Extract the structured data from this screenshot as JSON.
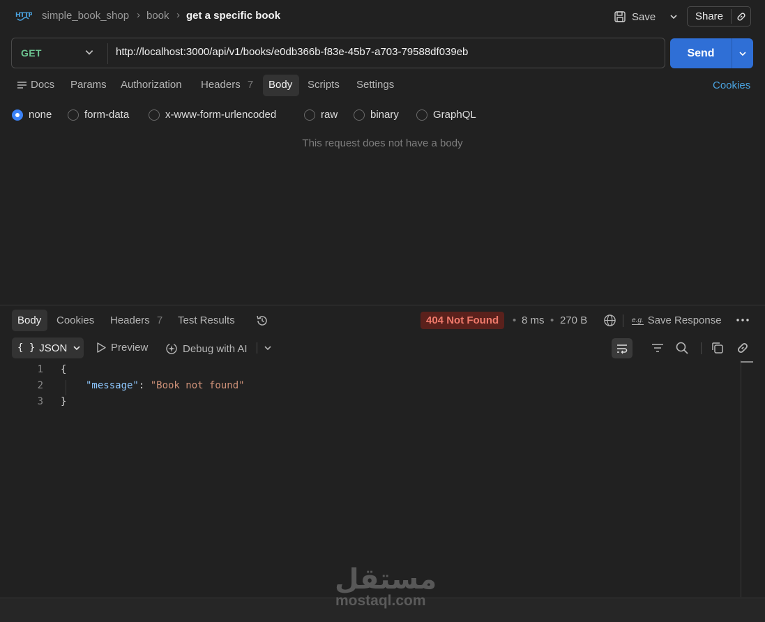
{
  "header": {
    "icon": "HTTP",
    "breadcrumb": [
      "simple_book_shop",
      "book",
      "get a specific book"
    ],
    "save_label": "Save",
    "share_label": "Share"
  },
  "request": {
    "method": "GET",
    "url": "http://localhost:3000/api/v1/books/e0db366b-f83e-45b7-a703-79588df039eb",
    "send_label": "Send",
    "tabs": [
      {
        "label": "Docs"
      },
      {
        "label": "Params"
      },
      {
        "label": "Authorization"
      },
      {
        "label": "Headers",
        "count": "7"
      },
      {
        "label": "Body",
        "active": true
      },
      {
        "label": "Scripts"
      },
      {
        "label": "Settings"
      }
    ],
    "cookies_label": "Cookies",
    "body_types": [
      "none",
      "form-data",
      "x-www-form-urlencoded",
      "raw",
      "binary",
      "GraphQL"
    ],
    "selected_body_type": "none",
    "empty_body_message": "This request does not have a body"
  },
  "response": {
    "tabs": [
      {
        "label": "Body",
        "active": true
      },
      {
        "label": "Cookies"
      },
      {
        "label": "Headers",
        "count": "7"
      },
      {
        "label": "Test Results"
      }
    ],
    "status": "404 Not Found",
    "status_color": "#5a211c",
    "time": "8 ms",
    "size": "270 B",
    "save_response_label": "Save Response",
    "save_response_icon_text": "e.g.",
    "format_label": "JSON",
    "format_icon": "{ }",
    "preview_label": "Preview",
    "debug_label": "Debug with AI",
    "code_lines": [
      {
        "num": "1",
        "open": "{"
      },
      {
        "num": "2",
        "key": "\"message\"",
        "colon": ": ",
        "value": "\"Book not found\""
      },
      {
        "num": "3",
        "close": "}"
      }
    ]
  },
  "watermark": {
    "arabic": "مستقل",
    "latin": "mostaql.com"
  },
  "colors": {
    "accent": "#2f6fd6",
    "method_get": "#6cc390",
    "link": "#4aa3e0",
    "status_error_text": "#f07a6b"
  }
}
